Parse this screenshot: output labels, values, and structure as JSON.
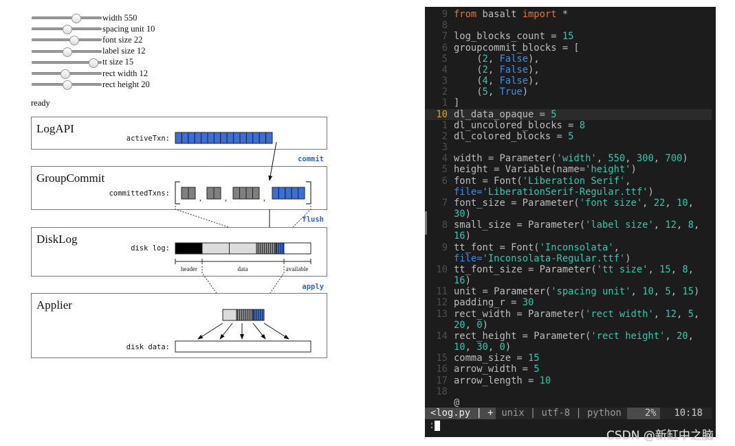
{
  "controls": {
    "sliders": [
      {
        "label": "width 550",
        "min": 300,
        "max": 700,
        "value": 550
      },
      {
        "label": "spacing unit 10",
        "min": 5,
        "max": 15,
        "value": 10
      },
      {
        "label": "font size 22",
        "min": 10,
        "max": 30,
        "value": 22
      },
      {
        "label": "label size 12",
        "min": 8,
        "max": 16,
        "value": 12
      },
      {
        "label": "tt size 15",
        "min": 8,
        "max": 16,
        "value": 15
      },
      {
        "label": "rect width 12",
        "min": 5,
        "max": 20,
        "value": 12
      },
      {
        "label": "rect height 20",
        "min": 10,
        "max": 30,
        "value": 20
      }
    ],
    "status": "ready"
  },
  "diagram": {
    "colors": {
      "blue": "#3a6fd8",
      "gray": "#7f7f7f",
      "light": "#dcdcdc",
      "black": "#000000",
      "accent_text": "#2f63c9"
    },
    "log_api": {
      "title": "LogAPI",
      "label": "activeTxn:",
      "blocks": 15
    },
    "commit_label": "commit",
    "group_commit": {
      "title": "GroupCommit",
      "label": "committedTxns:",
      "groups": [
        {
          "count": 2,
          "colored": false
        },
        {
          "count": 2,
          "colored": false
        },
        {
          "count": 4,
          "colored": false
        },
        {
          "count": 5,
          "colored": true
        }
      ],
      "separator": ","
    },
    "flush_label": "flush",
    "disk_log": {
      "title": "DiskLog",
      "label": "disk log:",
      "sections": [
        "header",
        "data",
        "available"
      ],
      "opaque": 5,
      "uncolored": 8,
      "colored": 5
    },
    "apply_label": "apply",
    "applier": {
      "title": "Applier",
      "label": "disk data:"
    }
  },
  "editor": {
    "lines": [
      {
        "n": "9",
        "t": [
          [
            "from",
            "k"
          ],
          [
            " basalt ",
            "d"
          ],
          [
            "import",
            "k"
          ],
          [
            " *",
            "d"
          ]
        ]
      },
      {
        "n": "8",
        "t": []
      },
      {
        "n": "7",
        "t": [
          [
            "log_blocks_count = ",
            "d"
          ],
          [
            "15",
            "n"
          ]
        ]
      },
      {
        "n": "6",
        "t": [
          [
            "groupcommit_blocks = [",
            "d"
          ]
        ]
      },
      {
        "n": "5",
        "t": [
          [
            "    (",
            "d"
          ],
          [
            "2",
            "n"
          ],
          [
            ", ",
            "d"
          ],
          [
            "False",
            "b"
          ],
          [
            "),",
            "d"
          ]
        ]
      },
      {
        "n": "4",
        "t": [
          [
            "    (",
            "d"
          ],
          [
            "2",
            "n"
          ],
          [
            ", ",
            "d"
          ],
          [
            "False",
            "b"
          ],
          [
            "),",
            "d"
          ]
        ]
      },
      {
        "n": "3",
        "t": [
          [
            "    (",
            "d"
          ],
          [
            "4",
            "n"
          ],
          [
            ", ",
            "d"
          ],
          [
            "False",
            "b"
          ],
          [
            "),",
            "d"
          ]
        ]
      },
      {
        "n": "2",
        "t": [
          [
            "    (",
            "d"
          ],
          [
            "5",
            "n"
          ],
          [
            ", ",
            "d"
          ],
          [
            "True",
            "b"
          ],
          [
            ")",
            "d"
          ]
        ]
      },
      {
        "n": "1",
        "t": [
          [
            "]",
            "d"
          ]
        ]
      },
      {
        "n": "10",
        "cur": true,
        "t": [
          [
            "dl_data_opaque = ",
            "d"
          ],
          [
            "5",
            "n"
          ]
        ]
      },
      {
        "n": "1",
        "t": [
          [
            "dl_uncolored_blocks = ",
            "d"
          ],
          [
            "8",
            "n"
          ]
        ]
      },
      {
        "n": "2",
        "t": [
          [
            "dl_colored_blocks = ",
            "d"
          ],
          [
            "5",
            "n"
          ]
        ]
      },
      {
        "n": "3",
        "t": []
      },
      {
        "n": "4",
        "t": [
          [
            "width = Parameter(",
            "d"
          ],
          [
            "'width'",
            "s"
          ],
          [
            ", ",
            "d"
          ],
          [
            "550",
            "n"
          ],
          [
            ", ",
            "d"
          ],
          [
            "300",
            "n"
          ],
          [
            ", ",
            "d"
          ],
          [
            "700",
            "n"
          ],
          [
            ")",
            "d"
          ]
        ]
      },
      {
        "n": "5",
        "t": [
          [
            "height = Variable(name=",
            "d"
          ],
          [
            "'height'",
            "s"
          ],
          [
            ")",
            "d"
          ]
        ]
      },
      {
        "n": "6",
        "t": [
          [
            "font = Font(",
            "d"
          ],
          [
            "'Liberation Serif'",
            "s"
          ],
          [
            ",",
            "d"
          ]
        ]
      },
      {
        "n": "",
        "t": [
          [
            "file=",
            "b"
          ],
          [
            "'LiberationSerif-Regular.ttf'",
            "s"
          ],
          [
            ")",
            "d"
          ]
        ]
      },
      {
        "n": "7",
        "t": [
          [
            "font_size = Parameter(",
            "d"
          ],
          [
            "'font size'",
            "s"
          ],
          [
            ", ",
            "d"
          ],
          [
            "22",
            "n"
          ],
          [
            ", ",
            "d"
          ],
          [
            "10",
            "n"
          ],
          [
            ",",
            "d"
          ]
        ]
      },
      {
        "n": "",
        "t": [
          [
            "30",
            "n"
          ],
          [
            ")",
            "d"
          ]
        ]
      },
      {
        "n": "8",
        "t": [
          [
            "small_size = Parameter(",
            "d"
          ],
          [
            "'label size'",
            "s"
          ],
          [
            ", ",
            "d"
          ],
          [
            "12",
            "n"
          ],
          [
            ", ",
            "d"
          ],
          [
            "8",
            "n"
          ],
          [
            ",",
            "d"
          ]
        ]
      },
      {
        "n": "",
        "t": [
          [
            "16",
            "n"
          ],
          [
            ")",
            "d"
          ]
        ]
      },
      {
        "n": "9",
        "t": [
          [
            "tt_font = Font(",
            "d"
          ],
          [
            "'Inconsolata'",
            "s"
          ],
          [
            ",",
            "d"
          ]
        ]
      },
      {
        "n": "",
        "t": [
          [
            "file=",
            "b"
          ],
          [
            "'Inconsolata-Regular.ttf'",
            "s"
          ],
          [
            ")",
            "d"
          ]
        ]
      },
      {
        "n": "10",
        "t": [
          [
            "tt_font_size = Parameter(",
            "d"
          ],
          [
            "'tt size'",
            "s"
          ],
          [
            ", ",
            "d"
          ],
          [
            "15",
            "n"
          ],
          [
            ", ",
            "d"
          ],
          [
            "8",
            "n"
          ],
          [
            ",",
            "d"
          ]
        ]
      },
      {
        "n": "",
        "t": [
          [
            "16",
            "n"
          ],
          [
            ")",
            "d"
          ]
        ]
      },
      {
        "n": "11",
        "t": [
          [
            "unit = Parameter(",
            "d"
          ],
          [
            "'spacing unit'",
            "s"
          ],
          [
            ", ",
            "d"
          ],
          [
            "10",
            "n"
          ],
          [
            ", ",
            "d"
          ],
          [
            "5",
            "n"
          ],
          [
            ", ",
            "d"
          ],
          [
            "15",
            "n"
          ],
          [
            ")",
            "d"
          ]
        ]
      },
      {
        "n": "12",
        "t": [
          [
            "padding_r = ",
            "d"
          ],
          [
            "30",
            "n"
          ]
        ]
      },
      {
        "n": "13",
        "t": [
          [
            "rect_width = Parameter(",
            "d"
          ],
          [
            "'rect width'",
            "s"
          ],
          [
            ", ",
            "d"
          ],
          [
            "12",
            "n"
          ],
          [
            ", ",
            "d"
          ],
          [
            "5",
            "n"
          ],
          [
            ",",
            "d"
          ]
        ]
      },
      {
        "n": "",
        "t": [
          [
            "20",
            "n"
          ],
          [
            ", ",
            "d"
          ],
          [
            "0",
            "n"
          ],
          [
            ")",
            "d"
          ]
        ]
      },
      {
        "n": "14",
        "t": [
          [
            "rect_height = Parameter(",
            "d"
          ],
          [
            "'rect height'",
            "s"
          ],
          [
            ", ",
            "d"
          ],
          [
            "20",
            "n"
          ],
          [
            ",",
            "d"
          ]
        ]
      },
      {
        "n": "",
        "t": [
          [
            "10",
            "n"
          ],
          [
            ", ",
            "d"
          ],
          [
            "30",
            "n"
          ],
          [
            ", ",
            "d"
          ],
          [
            "0",
            "n"
          ],
          [
            ")",
            "d"
          ]
        ]
      },
      {
        "n": "15",
        "t": [
          [
            "comma_size = ",
            "d"
          ],
          [
            "15",
            "n"
          ]
        ]
      },
      {
        "n": "16",
        "t": [
          [
            "arrow_width = ",
            "d"
          ],
          [
            "5",
            "n"
          ]
        ]
      },
      {
        "n": "17",
        "t": [
          [
            "arrow_length = ",
            "d"
          ],
          [
            "10",
            "n"
          ]
        ]
      },
      {
        "n": "18",
        "t": []
      },
      {
        "n": "",
        "t": [
          [
            "@",
            "d"
          ]
        ]
      }
    ],
    "statusline": {
      "file": "<log.py | +",
      "info": "unix | utf-8 | python",
      "percent": "2%",
      "position": "10:18"
    },
    "command": ":"
  },
  "watermark": "CSDN @新缸中之脑"
}
